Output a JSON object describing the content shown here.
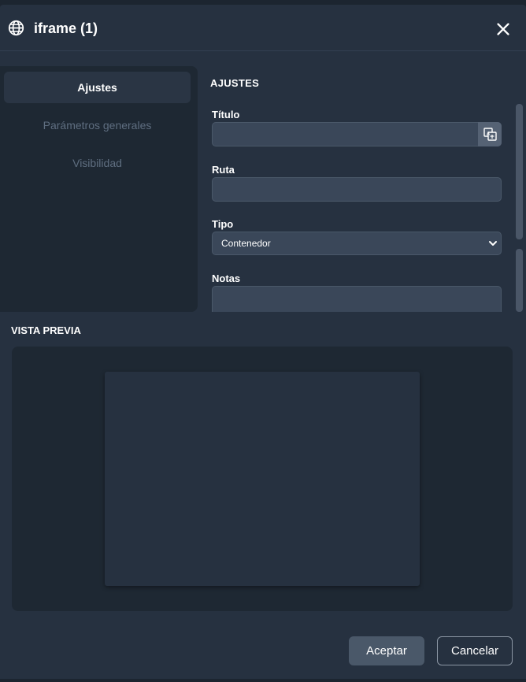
{
  "dialog": {
    "title": "iframe (1)",
    "icon": "globe-icon",
    "close_icon": "close-icon"
  },
  "sidebar": {
    "items": [
      {
        "label": "Ajustes",
        "active": true
      },
      {
        "label": "Parámetros generales",
        "active": false
      },
      {
        "label": "Visibilidad",
        "active": false
      }
    ]
  },
  "form": {
    "section_title": "AJUSTES",
    "titulo_label": "Título",
    "titulo_value": "",
    "ruta_label": "Ruta",
    "ruta_value": "",
    "tipo_label": "Tipo",
    "tipo_value": "Contenedor",
    "notas_label": "Notas"
  },
  "preview": {
    "title": "VISTA PREVIA"
  },
  "buttons": {
    "accept": "Aceptar",
    "cancel": "Cancelar"
  },
  "colors": {
    "dialog_bg": "#263140",
    "panel_bg": "#1e2833",
    "input_bg": "#3a4759"
  }
}
